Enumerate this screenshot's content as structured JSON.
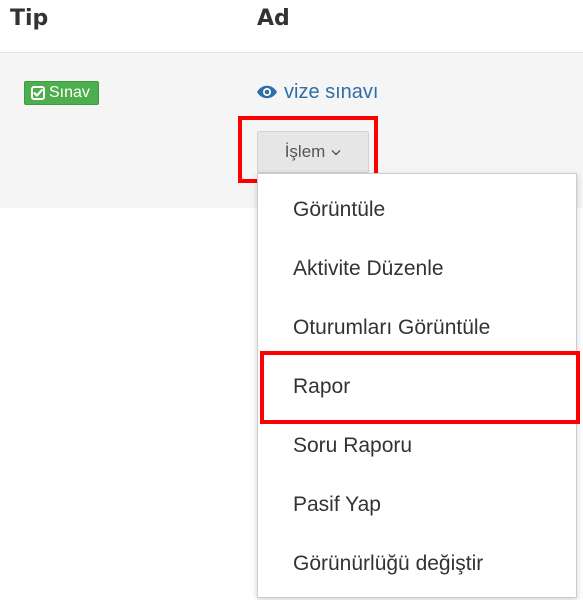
{
  "table": {
    "headers": {
      "tip": "Tip",
      "ad": "Ad"
    },
    "row": {
      "type_badge": "Sınav",
      "activity_name": "vize sınavı"
    }
  },
  "actions_button": {
    "label": "İşlem"
  },
  "menu": {
    "items": [
      {
        "label": "Görüntüle"
      },
      {
        "label": "Aktivite Düzenle"
      },
      {
        "label": "Oturumları Görüntüle"
      },
      {
        "label": "Rapor"
      },
      {
        "label": "Soru Raporu"
      },
      {
        "label": "Pasif Yap"
      },
      {
        "label": "Görünürlüğü değiştir"
      }
    ]
  },
  "icons": {
    "badge": "check-square-icon",
    "activity": "eye-icon",
    "dropdown": "chevron-down-icon"
  },
  "colors": {
    "badge_bg": "#4cae4c",
    "link": "#2f6fa8",
    "highlight": "#ff0000",
    "row_bg": "#f5f5f5"
  }
}
